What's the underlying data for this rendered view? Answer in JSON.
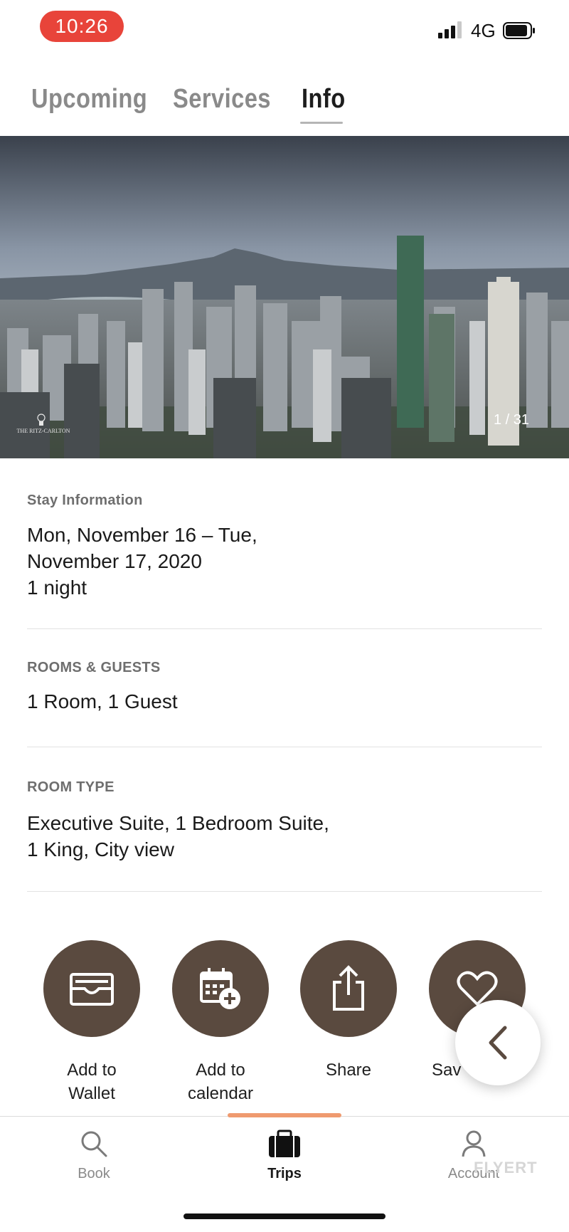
{
  "status_bar": {
    "time": "10:26",
    "network": "4G"
  },
  "tabs": [
    {
      "label": "Upcoming"
    },
    {
      "label": "Services"
    },
    {
      "label": "Info"
    }
  ],
  "hero": {
    "counter": "1 / 31",
    "logo_text": "THE RITZ-CARLTON"
  },
  "stay": {
    "label": "Stay Information",
    "line1": "Mon, November 16 – Tue,",
    "line2": "November 17, 2020",
    "line3": "1 night"
  },
  "rooms_guests": {
    "label": "ROOMS & GUESTS",
    "value": "1 Room, 1 Guest"
  },
  "room_type": {
    "label": "ROOM TYPE",
    "line1": "Executive Suite, 1 Bedroom Suite,",
    "line2": "1 King, City view"
  },
  "actions": [
    {
      "line1": "Add to",
      "line2": "Wallet",
      "icon": "wallet-icon"
    },
    {
      "line1": "Add to",
      "line2": "calendar",
      "icon": "calendar-add-icon"
    },
    {
      "line1": "Share",
      "line2": "",
      "icon": "share-icon"
    },
    {
      "line1": "Sav",
      "line2": "",
      "icon": "heart-icon"
    }
  ],
  "bottom_nav": [
    {
      "label": "Book",
      "icon": "search-icon"
    },
    {
      "label": "Trips",
      "icon": "briefcase-icon"
    },
    {
      "label": "Account",
      "icon": "person-icon"
    }
  ],
  "watermark": "FLYERT",
  "colors": {
    "accent_brown": "#5a4a3f",
    "time_pill": "#e8443a",
    "nav_indicator": "#ef9a6f"
  }
}
